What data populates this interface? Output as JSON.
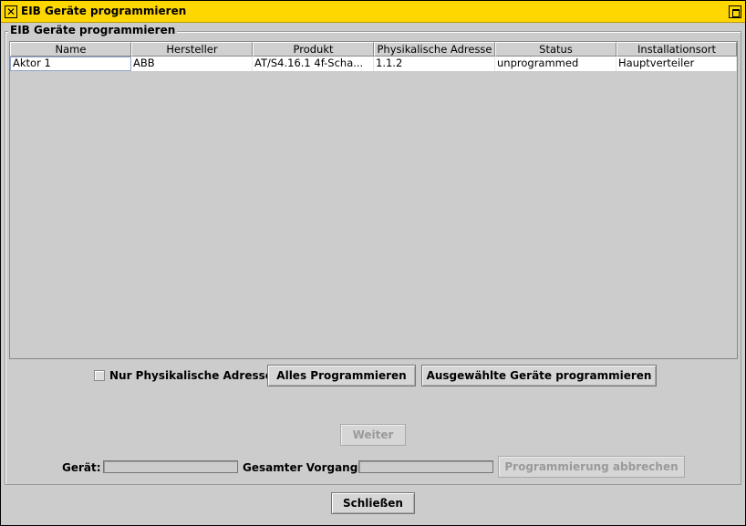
{
  "window": {
    "title": "EIB Geräte programmieren",
    "close_glyph": "✕"
  },
  "group": {
    "legend": "EIB Geräte programmieren"
  },
  "table": {
    "columns": [
      "Name",
      "Hersteller",
      "Produkt",
      "Physikalische Adresse",
      "Status",
      "Installationsort"
    ],
    "rows": [
      [
        "Aktor 1",
        "ABB",
        "AT/S4.16.1 4f-Scha...",
        "1.1.2",
        "unprogrammed",
        "Hauptverteiler"
      ]
    ]
  },
  "options": {
    "phys_only_label": "Nur Physikalische Adresse",
    "phys_only_checked": false
  },
  "buttons": {
    "program_all": "Alles Programmieren",
    "program_selected": "Ausgewählte Geräte programmieren",
    "next": "Weiter",
    "cancel_programming": "Programmierung abbrechen",
    "close": "Schließen"
  },
  "progress": {
    "device_label": "Gerät:",
    "device_value": 0,
    "total_label": "Gesamter Vorgang:",
    "total_value": 0
  },
  "icons": {
    "close": "close-icon",
    "maximize": "maximize-icon"
  }
}
